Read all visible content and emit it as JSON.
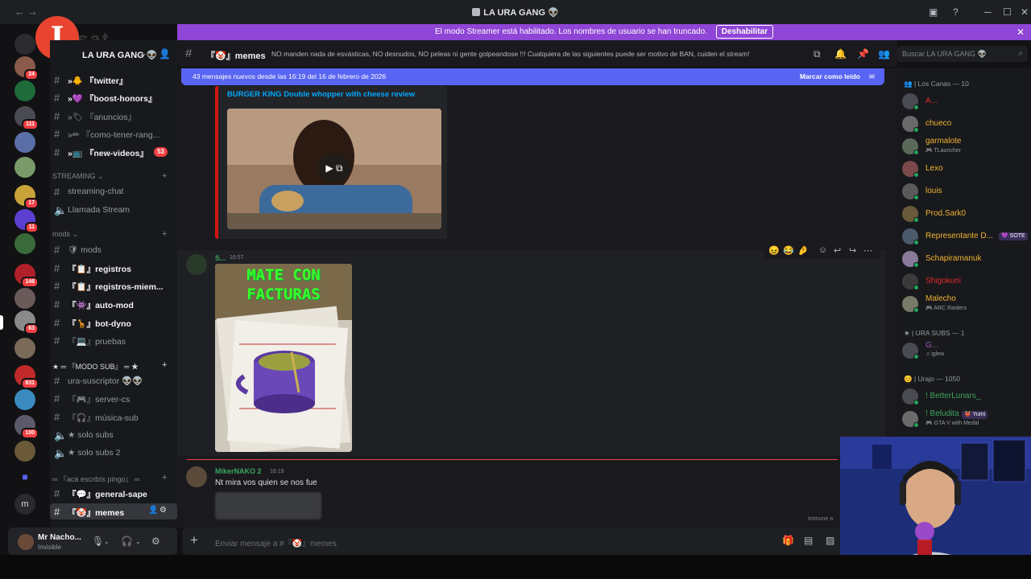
{
  "titlebar": {
    "back": "←",
    "forward": "→",
    "title": "LA URA GANG 👽"
  },
  "banner": {
    "text": "El modo Streamer está habilitado. Los nombres de usuario se han truncado.",
    "button": "Deshabilitar",
    "close": "✕"
  },
  "rail": {
    "badges": [
      "15",
      "24",
      "111",
      "17",
      "11",
      "146",
      "63",
      "831",
      "100"
    ]
  },
  "logo": {
    "letter": "I",
    "text": "sat"
  },
  "sidebar": {
    "guild_name": "LA URA GANG 👽",
    "channels": [
      {
        "name": "»🐥 『twitter』",
        "unread": true
      },
      {
        "name": "»💜 『boost-honors』",
        "unread": true
      },
      {
        "name": "»🏷 『anuncios』",
        "unread": false
      },
      {
        "name": "»✏ 『como-tener-rang...",
        "unread": false
      },
      {
        "name": "»📺 『new-videos』",
        "unread": true,
        "count": "53"
      }
    ],
    "cat_streaming": "STREAMING ⌄",
    "streaming": [
      {
        "name": "streaming-chat",
        "voice": false
      },
      {
        "name": "Llamada Stream",
        "voice": true
      }
    ],
    "cat_mods": "mods ⌄",
    "mods": [
      {
        "name": "🛡 mods",
        "unread": false
      },
      {
        "name": "『📋』registros",
        "unread": true
      },
      {
        "name": "『📋』registros-miem...",
        "unread": true
      },
      {
        "name": "『👾』auto-mod",
        "unread": true
      },
      {
        "name": "『🦒』bot-dyno",
        "unread": true
      },
      {
        "name": "『💻』pruebas",
        "unread": false
      }
    ],
    "cat_sub": "★ ═ 『MODO SUB』 ═ ★",
    "sub": [
      {
        "name": "ura-suscriptor 👽👽",
        "voice": false
      },
      {
        "name": "『🎮』server-cs",
        "voice": false
      },
      {
        "name": "『🎧』música-sub",
        "voice": false
      },
      {
        "name": "★ solo subs",
        "voice": true
      },
      {
        "name": "★ solo subs 2",
        "voice": true
      }
    ],
    "cat_pingo": "═ 『acá escribís pingo』 ═",
    "pingo": [
      {
        "name": "『💬』general-sape",
        "unread": true
      },
      {
        "name": "『🤡』memes",
        "active": true
      }
    ]
  },
  "user": {
    "name": "Mr Nacho...",
    "status": "Invisible"
  },
  "chat": {
    "channel": "『🤡』memes",
    "topic": "NO manden nada de esvásticas, NO desnudos, NO peleas ni gente golpeandose !!! Cualquiera de las siguientes puede ser motivo de BAN, cuiden el stream!",
    "new_bar": "43 mensajes nuevos desde las 16:19 del 16 de febrero de 2026",
    "mark_read": "Marcar como leído",
    "embed_title": "BURGER KING Double whopper with cheese review",
    "msg2_user": "S...",
    "msg2_time": "16:57",
    "image_caption": "MATE CON FACTURAS",
    "msg3_user": "MikerNAKO 2",
    "msg3_time": "16:19",
    "msg3_text": "Nt mira vos quien se nos fue",
    "immune": "Immune a",
    "composer_placeholder": "Enviar mensaje a #『🤡』memes"
  },
  "search": {
    "placeholder": "Buscar LA URA GANG 👽"
  },
  "members": {
    "cat1": "👥 | Los Canas — 10",
    "list1": [
      {
        "name": "A...",
        "color": "#e02b2b",
        "status": ""
      },
      {
        "name": "chueco",
        "color": "#f0b232",
        "status": ""
      },
      {
        "name": "garmalote",
        "color": "#f0b232",
        "status": "🎮 TLauncher"
      },
      {
        "name": "Lexo",
        "color": "#f0b232",
        "status": ""
      },
      {
        "name": "louis",
        "color": "#f0b232",
        "status": ""
      },
      {
        "name": "Prod.Sark0",
        "color": "#f0b232",
        "status": ""
      },
      {
        "name": "Representante D...",
        "color": "#f0b232",
        "status": "",
        "tag": "💜 SOTE"
      },
      {
        "name": "Schapiramanuk",
        "color": "#f0b232",
        "status": ""
      },
      {
        "name": "Shigokuni",
        "color": "#e02b2b",
        "status": ""
      },
      {
        "name": "Malecho",
        "color": "#f0b232",
        "status": "🎮 ARC Raiders"
      }
    ],
    "cat2": "★ | URA SUBS — 1",
    "list2": [
      {
        "name": "G...",
        "color": "#9b59b6",
        "status": "♫ iglew"
      }
    ],
    "cat3": "😊 | Urajo — 1050",
    "list3": [
      {
        "name": "! BetterLunars_",
        "color": "#3ba55c",
        "status": ""
      },
      {
        "name": "! Beludita",
        "color": "#3ba55c",
        "status": "🎮 GTA V with Medal",
        "tag": "👹 Yumi"
      }
    ]
  }
}
